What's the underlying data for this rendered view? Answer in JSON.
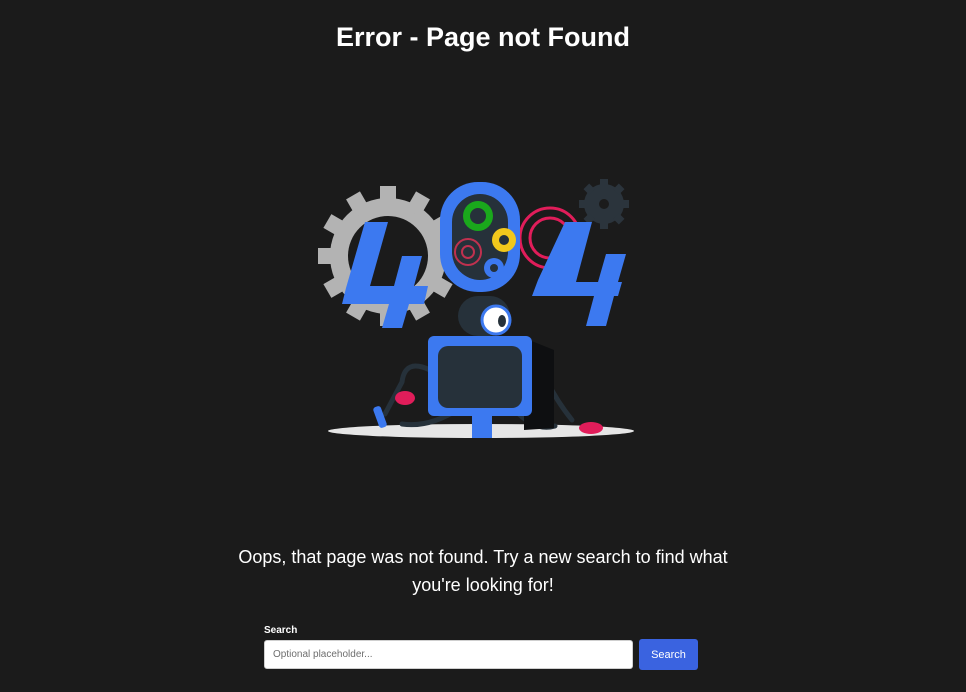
{
  "page": {
    "title": "Error - Page not Found"
  },
  "illustration": {
    "icon_name": "404-robot-illustration",
    "colors": {
      "blue": "#3c79f0",
      "gear_grey": "#b3b3b3",
      "dark": "#26313a",
      "pink": "#e11d5a",
      "green": "#1aa81c",
      "yellow": "#f2c81c"
    }
  },
  "message": {
    "text": "Oops, that page was not found. Try a new search to find what you're looking for!"
  },
  "search": {
    "label": "Search",
    "placeholder": "Optional placeholder...",
    "value": "",
    "button_label": "Search",
    "button_color": "#3a63e0"
  }
}
